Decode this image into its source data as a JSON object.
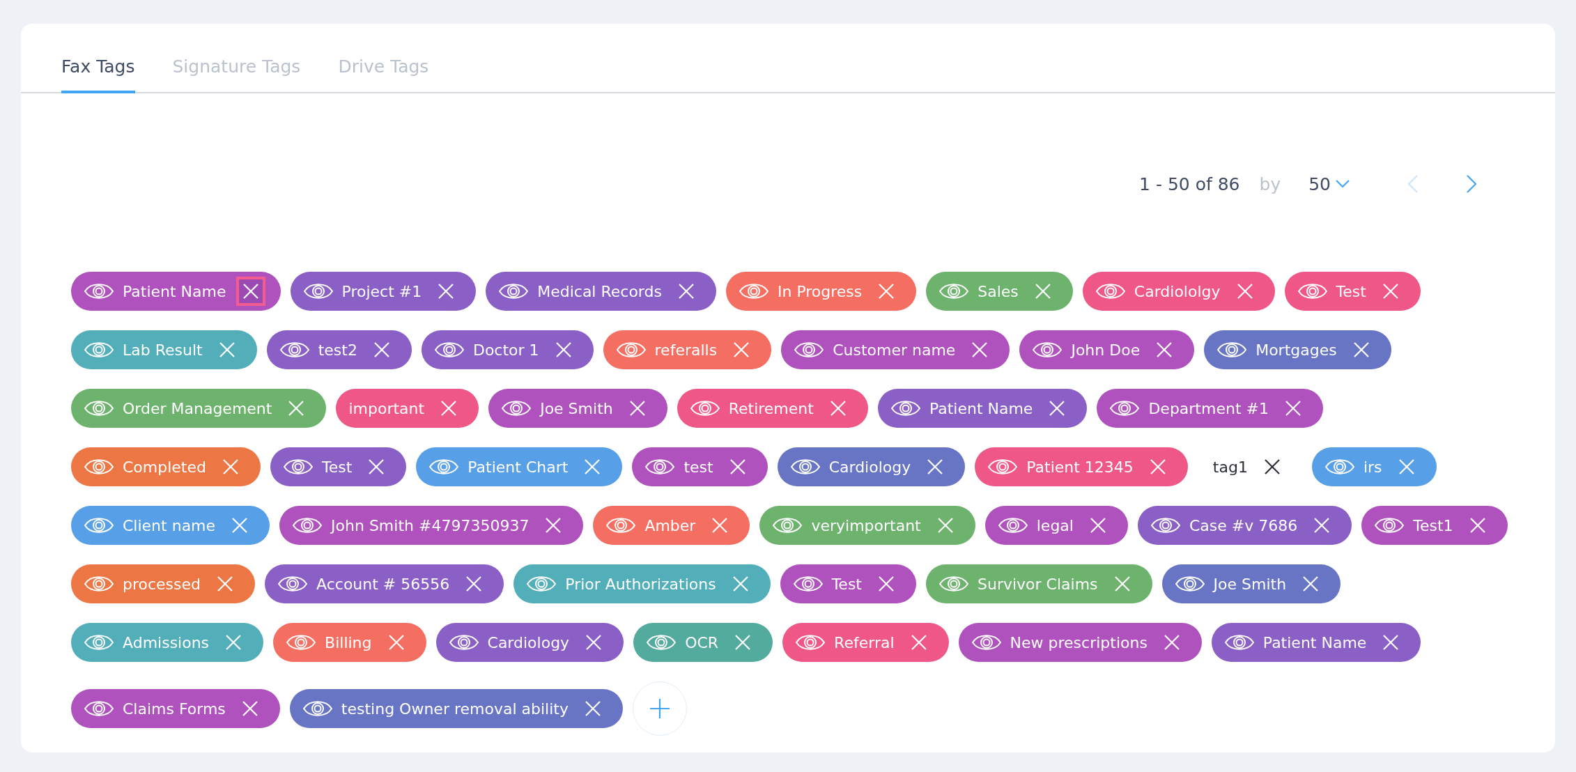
{
  "tabs": [
    {
      "label": "Fax Tags",
      "selected": true
    },
    {
      "label": "Signature Tags",
      "selected": false
    },
    {
      "label": "Drive Tags",
      "selected": false
    }
  ],
  "pagination": {
    "range": "1 - 50 of 86",
    "by": "by",
    "page_size": "50",
    "prev_disabled": true,
    "next_disabled": false
  },
  "tag_rows": [
    {
      "tags": [
        {
          "kind": "pill",
          "label": "Patient Name",
          "color": "#b052bd",
          "eye": true,
          "remove_focused": true
        },
        {
          "kind": "pill",
          "label": "Project #1",
          "color": "#8a5fc6",
          "eye": true,
          "remove_focused": false
        },
        {
          "kind": "pill",
          "label": "Medical Records",
          "color": "#8a5fc6",
          "eye": true,
          "remove_focused": false
        },
        {
          "kind": "pill",
          "label": "In Progress",
          "color": "#f46f62",
          "eye": true,
          "remove_focused": false
        },
        {
          "kind": "pill",
          "label": "Sales",
          "color": "#6db36d",
          "eye": true,
          "remove_focused": false
        },
        {
          "kind": "pill",
          "label": "Cardiololgy",
          "color": "#ef5786",
          "eye": true,
          "remove_focused": false
        },
        {
          "kind": "pill",
          "label": "Test",
          "color": "#ef5786",
          "eye": true,
          "remove_focused": false
        }
      ]
    },
    {
      "tags": [
        {
          "kind": "pill",
          "label": "Lab Result",
          "color": "#52aeb9",
          "eye": true,
          "remove_focused": false
        },
        {
          "kind": "pill",
          "label": "test2",
          "color": "#8a5fc6",
          "eye": true,
          "remove_focused": false
        },
        {
          "kind": "pill",
          "label": "Doctor 1",
          "color": "#8a5fc6",
          "eye": true,
          "remove_focused": false
        },
        {
          "kind": "pill",
          "label": "referalls",
          "color": "#f46f62",
          "eye": true,
          "remove_focused": false
        },
        {
          "kind": "pill",
          "label": "Customer name",
          "color": "#b052bd",
          "eye": true,
          "remove_focused": false
        },
        {
          "kind": "pill",
          "label": "John Doe",
          "color": "#b052bd",
          "eye": true,
          "remove_focused": false
        },
        {
          "kind": "pill",
          "label": "Mortgages",
          "color": "#6875c4",
          "eye": true,
          "remove_focused": false
        }
      ]
    },
    {
      "tags": [
        {
          "kind": "pill",
          "label": "Order Management",
          "color": "#6db36d",
          "eye": true,
          "remove_focused": false
        },
        {
          "kind": "pill",
          "label": "important",
          "color": "#ef5786",
          "eye": false,
          "remove_focused": false
        },
        {
          "kind": "pill",
          "label": "Joe Smith",
          "color": "#b052bd",
          "eye": true,
          "remove_focused": false
        },
        {
          "kind": "pill",
          "label": "Retirement",
          "color": "#ef5786",
          "eye": true,
          "remove_focused": false
        },
        {
          "kind": "pill",
          "label": "Patient Name",
          "color": "#8a5fc6",
          "eye": true,
          "remove_focused": false
        },
        {
          "kind": "pill",
          "label": "Department #1",
          "color": "#b052bd",
          "eye": true,
          "remove_focused": false
        }
      ]
    },
    {
      "tags": [
        {
          "kind": "pill",
          "label": "Completed",
          "color": "#ec7745",
          "eye": true,
          "remove_focused": false
        },
        {
          "kind": "pill",
          "label": "Test",
          "color": "#8a5fc6",
          "eye": true,
          "remove_focused": false
        },
        {
          "kind": "pill",
          "label": "Patient Chart",
          "color": "#57a0e8",
          "eye": true,
          "remove_focused": false
        },
        {
          "kind": "pill",
          "label": "test",
          "color": "#b052bd",
          "eye": true,
          "remove_focused": false
        },
        {
          "kind": "pill",
          "label": "Cardiology",
          "color": "#6875c4",
          "eye": true,
          "remove_focused": false
        },
        {
          "kind": "pill",
          "label": "Patient 12345",
          "color": "#ef5786",
          "eye": true,
          "remove_focused": false
        },
        {
          "kind": "plain",
          "label": "tag1",
          "eye": false,
          "remove_focused": false
        },
        {
          "kind": "pill",
          "label": "irs",
          "color": "#57a0e8",
          "eye": true,
          "remove_focused": false
        }
      ]
    },
    {
      "tags": [
        {
          "kind": "pill",
          "label": "Client name",
          "color": "#57a0e8",
          "eye": true,
          "remove_focused": false
        },
        {
          "kind": "pill",
          "label": "John Smith #4797350937",
          "color": "#b052bd",
          "eye": true,
          "remove_focused": false
        },
        {
          "kind": "pill",
          "label": "Amber",
          "color": "#f46f62",
          "eye": true,
          "remove_focused": false
        },
        {
          "kind": "pill",
          "label": "veryimportant",
          "color": "#6db36d",
          "eye": true,
          "remove_focused": false
        },
        {
          "kind": "pill",
          "label": "legal",
          "color": "#b052bd",
          "eye": true,
          "remove_focused": false
        },
        {
          "kind": "pill",
          "label": "Case #v 7686",
          "color": "#8a5fc6",
          "eye": true,
          "remove_focused": false
        },
        {
          "kind": "pill",
          "label": "Test1",
          "color": "#b052bd",
          "eye": true,
          "remove_focused": false
        }
      ]
    },
    {
      "tags": [
        {
          "kind": "pill",
          "label": "processed",
          "color": "#ec7745",
          "eye": true,
          "remove_focused": false
        },
        {
          "kind": "pill",
          "label": "Account # 56556",
          "color": "#8a5fc6",
          "eye": true,
          "remove_focused": false
        },
        {
          "kind": "pill",
          "label": "Prior Authorizations",
          "color": "#52aeb9",
          "eye": true,
          "remove_focused": false
        },
        {
          "kind": "pill",
          "label": "Test",
          "color": "#b052bd",
          "eye": true,
          "remove_focused": false
        },
        {
          "kind": "pill",
          "label": "Survivor Claims",
          "color": "#6db36d",
          "eye": true,
          "remove_focused": false
        },
        {
          "kind": "pill",
          "label": "Joe Smith",
          "color": "#6875c4",
          "eye": true,
          "remove_focused": false
        }
      ]
    },
    {
      "tags": [
        {
          "kind": "pill",
          "label": "Admissions",
          "color": "#52aeb9",
          "eye": true,
          "remove_focused": false
        },
        {
          "kind": "pill",
          "label": "Billing",
          "color": "#f46f62",
          "eye": true,
          "remove_focused": false
        },
        {
          "kind": "pill",
          "label": "Cardiology",
          "color": "#8a5fc6",
          "eye": true,
          "remove_focused": false
        },
        {
          "kind": "pill",
          "label": "OCR",
          "color": "#52ab9d",
          "eye": true,
          "remove_focused": false
        },
        {
          "kind": "pill",
          "label": "Referral",
          "color": "#ef5786",
          "eye": true,
          "remove_focused": false
        },
        {
          "kind": "pill",
          "label": "New prescriptions",
          "color": "#b052bd",
          "eye": true,
          "remove_focused": false
        },
        {
          "kind": "pill",
          "label": "Patient Name",
          "color": "#8a5fc6",
          "eye": true,
          "remove_focused": false
        }
      ]
    },
    {
      "tags": [
        {
          "kind": "pill",
          "label": "Claims Forms",
          "color": "#b052bd",
          "eye": true,
          "remove_focused": false
        },
        {
          "kind": "pill",
          "label": "testing Owner removal ability",
          "color": "#6875c4",
          "eye": true,
          "remove_focused": false
        }
      ]
    }
  ]
}
